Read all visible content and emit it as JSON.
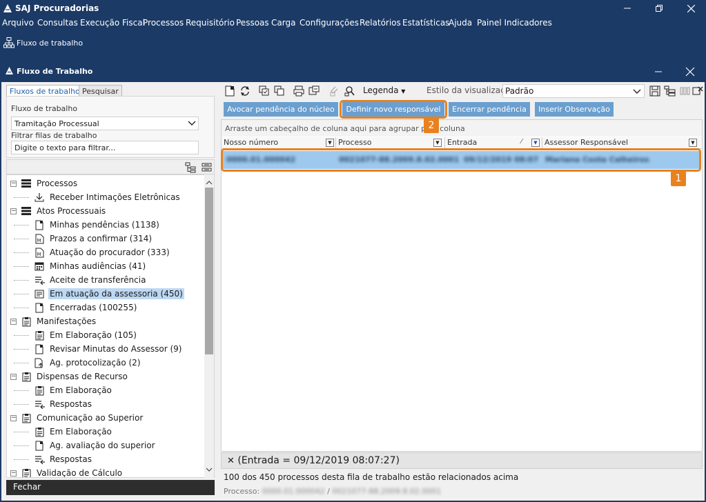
{
  "app": {
    "title": "SAJ Procuradorias",
    "menu": [
      "Arquivo",
      "Consultas",
      "Execução Fiscal",
      "Processos",
      "Requisitório",
      "Pessoas",
      "Carga",
      "Configurações",
      "Relatórios",
      "Estatísticas",
      "Ajuda",
      "Painel Indicadores"
    ],
    "toolstrip_label": "Fluxo de trabalho"
  },
  "window": {
    "title": "Fluxo de Trabalho"
  },
  "left": {
    "tabs": [
      "Fluxos de trabalho",
      "Pesquisar"
    ],
    "flow_label": "Fluxo de trabalho",
    "flow_value": "Tramitação Processual",
    "filter_label": "Filtrar filas de trabalho",
    "filter_value": "Digite o texto para filtrar...",
    "close_button": "Fechar"
  },
  "tree": [
    {
      "label": "Processos",
      "icon": "list-icon",
      "level": 0,
      "expanded": true
    },
    {
      "label": "Receber Intimações Eletrônicas",
      "icon": "download-icon",
      "level": 1
    },
    {
      "label": "Atos Processuais",
      "icon": "list-icon",
      "level": 0,
      "expanded": true
    },
    {
      "label": "Minhas pendências (1138)",
      "icon": "document-icon",
      "level": 1
    },
    {
      "label": "Prazos a confirmar (314)",
      "icon": "doc-m-icon",
      "level": 1
    },
    {
      "label": "Atuação do procurador (333)",
      "icon": "doc-m-icon",
      "level": 1
    },
    {
      "label": "Minhas audiências (41)",
      "icon": "calendar-icon",
      "level": 1
    },
    {
      "label": "Aceite de transferência",
      "icon": "transfer-icon",
      "level": 1
    },
    {
      "label": "Em atuação da assessoria (450)",
      "icon": "form-icon",
      "level": 1,
      "selected": true
    },
    {
      "label": "Encerradas (100255)",
      "icon": "document-icon",
      "level": 1
    },
    {
      "label": "Manifestações",
      "icon": "clipboard-icon",
      "level": 0,
      "expanded": true
    },
    {
      "label": "Em Elaboração (105)",
      "icon": "clipboard-icon",
      "level": 1
    },
    {
      "label": "Revisar Minutas do Assessor (9)",
      "icon": "document-icon",
      "level": 1
    },
    {
      "label": "Ag. protocolização (2)",
      "icon": "doc-send-icon",
      "level": 1
    },
    {
      "label": "Dispensas de Recurso",
      "icon": "clipboard-icon",
      "level": 0,
      "expanded": true
    },
    {
      "label": "Em Elaboração",
      "icon": "clipboard-icon",
      "level": 1
    },
    {
      "label": "Respostas",
      "icon": "transfer-icon",
      "level": 1
    },
    {
      "label": "Comunicação ao Superior",
      "icon": "clipboard-icon",
      "level": 0,
      "expanded": true
    },
    {
      "label": "Em Elaboração",
      "icon": "clipboard-icon",
      "level": 1
    },
    {
      "label": "Ag. avaliação do superior",
      "icon": "document-icon",
      "level": 1
    },
    {
      "label": "Respostas",
      "icon": "transfer-icon",
      "level": 1
    },
    {
      "label": "Validação de Cálculo",
      "icon": "clipboard-icon",
      "level": 0,
      "expanded": true
    }
  ],
  "toolbar": {
    "legenda": "Legenda",
    "estilo_label": "Estilo da visualização",
    "estilo_value": "Padrão"
  },
  "actions": [
    "Avocar pendência do núcleo",
    "Definir novo responsável",
    "Encerrar pendência",
    "Inserir Observação"
  ],
  "grid": {
    "group_hint": "Arraste um cabeçalho de coluna aqui para agrupar pela coluna",
    "columns": [
      "Nosso número",
      "Processo",
      "Entrada",
      "Assessor Responsável"
    ],
    "row": [
      "0000.01.000042",
      "0021077-88.2009.8.02.0001",
      "09/12/2019 08:07",
      "Mariana Costa Calheiros"
    ]
  },
  "callouts": [
    "1",
    "2"
  ],
  "filter_text": "(Entrada = 09/12/2019 08:07:27)",
  "status": {
    "summary": "100 dos 450 processos desta fila de trabalho estão relacionados acima",
    "processo_label": "Processo:",
    "processo_sep": "/",
    "processo_left": "0000.01.000042",
    "processo_right": "0021077-88.2009.8.02.0001"
  }
}
